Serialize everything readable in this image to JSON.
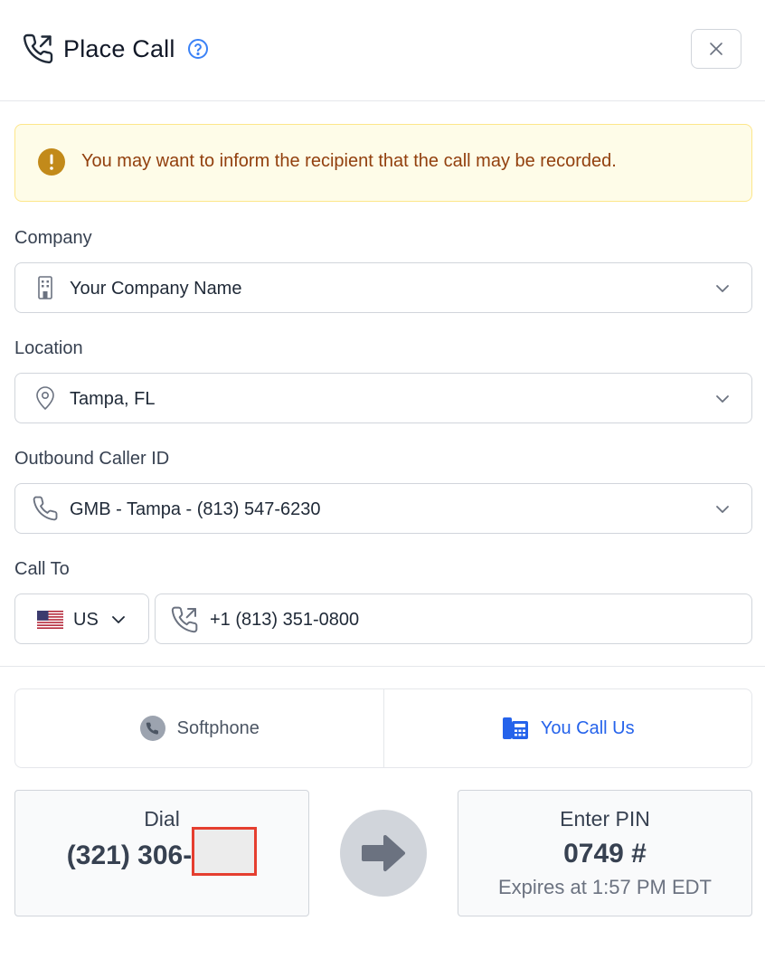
{
  "header": {
    "title": "Place Call"
  },
  "alert": {
    "message": "You may want to inform the recipient that the call may be recorded."
  },
  "company": {
    "label": "Company",
    "value": "Your Company Name"
  },
  "location": {
    "label": "Location",
    "value": "Tampa, FL"
  },
  "caller_id": {
    "label": "Outbound Caller ID",
    "value": "GMB - Tampa - (813) 547-6230"
  },
  "call_to": {
    "label": "Call To",
    "country": "US",
    "phone": "+1 (813) 351-0800"
  },
  "tabs": [
    {
      "label": "Softphone",
      "active": false
    },
    {
      "label": "You Call Us",
      "active": true
    }
  ],
  "dial": {
    "label": "Dial",
    "number_prefix": "(321) 306-"
  },
  "pin": {
    "label": "Enter PIN",
    "value": "0749 #",
    "expires": "Expires at 1:57 PM EDT"
  },
  "colors": {
    "accent": "#2563eb",
    "warning_bg": "#fefce8",
    "warning_text": "#92400e",
    "redaction": "#e53e2f"
  }
}
